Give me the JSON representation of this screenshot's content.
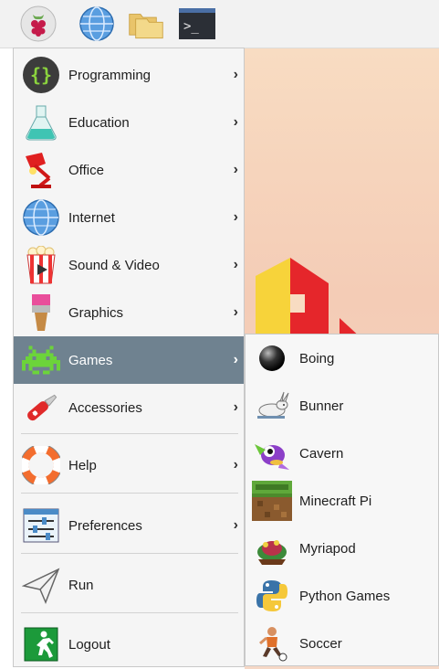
{
  "taskbar": {
    "buttons": [
      {
        "icon": "raspberry-pi-menu-icon"
      },
      {
        "icon": "web-browser-globe-icon"
      },
      {
        "icon": "file-manager-folder-icon"
      },
      {
        "icon": "terminal-icon",
        "text": ">_"
      }
    ]
  },
  "menu": {
    "items": [
      {
        "label": "Programming",
        "icon": "programming-icon",
        "submenu": true
      },
      {
        "label": "Education",
        "icon": "education-flask-icon",
        "submenu": true
      },
      {
        "label": "Office",
        "icon": "office-lamp-icon",
        "submenu": true
      },
      {
        "label": "Internet",
        "icon": "internet-globe-icon",
        "submenu": true
      },
      {
        "label": "Sound & Video",
        "icon": "sound-video-popcorn-icon",
        "submenu": true
      },
      {
        "label": "Graphics",
        "icon": "graphics-brush-icon",
        "submenu": true
      },
      {
        "label": "Games",
        "icon": "games-invader-icon",
        "submenu": true,
        "selected": true
      },
      {
        "label": "Accessories",
        "icon": "accessories-knife-icon",
        "submenu": true
      },
      {
        "label": "Help",
        "icon": "help-lifebuoy-icon",
        "submenu": true
      },
      {
        "label": "Preferences",
        "icon": "preferences-sliders-icon",
        "submenu": true
      },
      {
        "label": "Run",
        "icon": "run-paper-plane-icon",
        "submenu": false
      },
      {
        "label": "Logout",
        "icon": "logout-exit-icon",
        "submenu": false
      }
    ],
    "arrow": "›",
    "selected_color": "#6f8290"
  },
  "games_submenu": {
    "items": [
      {
        "label": "Boing",
        "icon": "boing-ball-icon"
      },
      {
        "label": "Bunner",
        "icon": "bunner-rabbit-icon"
      },
      {
        "label": "Cavern",
        "icon": "cavern-dragon-icon"
      },
      {
        "label": "Minecraft Pi",
        "icon": "minecraft-block-icon"
      },
      {
        "label": "Myriapod",
        "icon": "myriapod-bug-icon"
      },
      {
        "label": "Python Games",
        "icon": "python-logo-icon"
      },
      {
        "label": "Soccer",
        "icon": "soccer-player-icon"
      }
    ]
  }
}
